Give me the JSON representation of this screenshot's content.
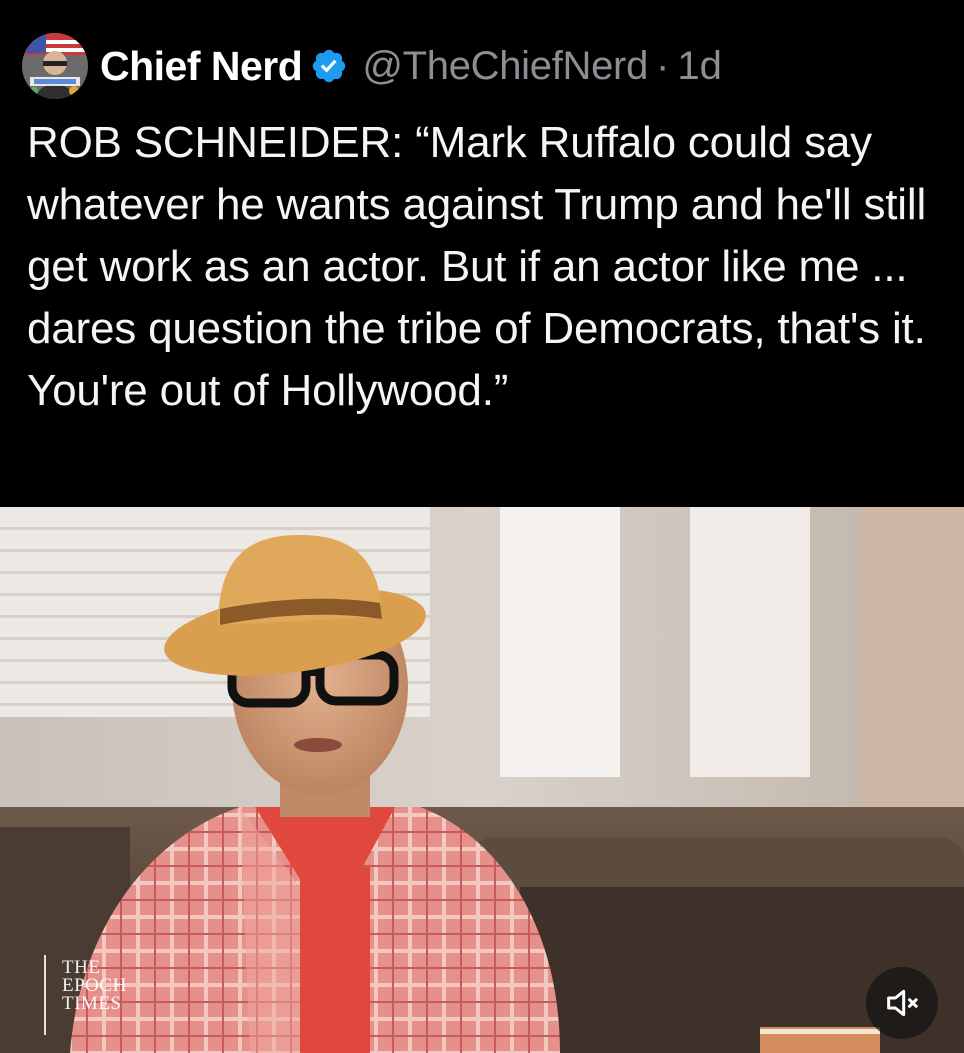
{
  "post": {
    "author": {
      "display_name": "Chief Nerd",
      "handle": "@TheChiefNerd",
      "verified": true,
      "avatar_icon": "chief-nerd-avatar"
    },
    "separator": "·",
    "timestamp": "1d",
    "text": "ROB SCHNEIDER: “Mark Ruffalo could say whatever he wants against Trump and he'll still get work as an actor. But if an actor like me ... dares question the tribe of Democrats, that's it. You're out of Hollywood.”"
  },
  "media": {
    "type": "video",
    "watermark": {
      "line1": "THE",
      "line2": "EPOCH",
      "line3": "TIMES"
    },
    "mute_icon": "speaker-muted-icon"
  },
  "colors": {
    "background": "#000000",
    "text": "#e7e9ea",
    "secondary_text": "#8b8e93",
    "verified_badge": "#1d9bf0"
  }
}
